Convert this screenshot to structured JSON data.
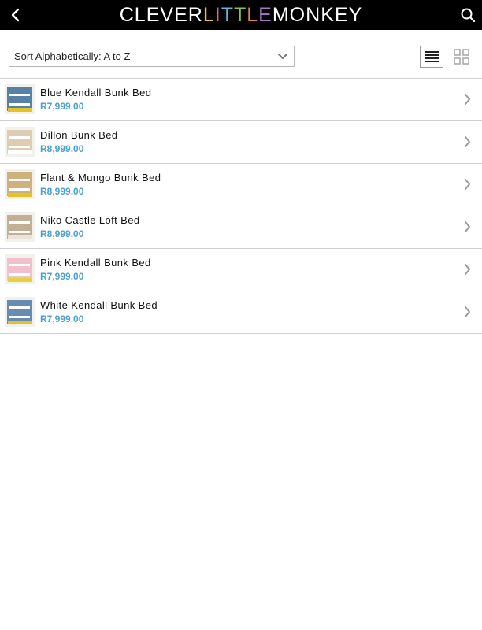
{
  "header": {
    "back_icon": "chevron-left-icon",
    "search_icon": "search-icon",
    "logo_letters": [
      {
        "char": "C",
        "color": "#ffffff"
      },
      {
        "char": "L",
        "color": "#ffffff"
      },
      {
        "char": "E",
        "color": "#ffffff"
      },
      {
        "char": "V",
        "color": "#ffffff"
      },
      {
        "char": "E",
        "color": "#ffffff"
      },
      {
        "char": "R",
        "color": "#ffffff"
      },
      {
        "char": "L",
        "color": "#f2c12e"
      },
      {
        "char": "I",
        "color": "#e8628a"
      },
      {
        "char": "T",
        "color": "#5bb6e0"
      },
      {
        "char": "T",
        "color": "#8ec044"
      },
      {
        "char": "L",
        "color": "#e5883a"
      },
      {
        "char": "E",
        "color": "#a577c9"
      },
      {
        "char": "M",
        "color": "#ffffff"
      },
      {
        "char": "O",
        "color": "#ffffff"
      },
      {
        "char": "N",
        "color": "#ffffff"
      },
      {
        "char": "K",
        "color": "#ffffff"
      },
      {
        "char": "E",
        "color": "#ffffff"
      },
      {
        "char": "Y",
        "color": "#ffffff"
      }
    ]
  },
  "toolbar": {
    "sort_label": "Sort Alphabetically: A to Z",
    "sort_icon": "chevron-down-icon",
    "list_view_icon": "list-view-icon",
    "grid_view_icon": "grid-view-icon"
  },
  "products": [
    {
      "name": "Blue Kendall Bunk Bed",
      "price": "R7,999.00",
      "thumb_color": "#3b6f9a",
      "accent": "#e6c22a"
    },
    {
      "name": "Dillon Bunk Bed",
      "price": "R8,999.00",
      "thumb_color": "#d9c7a8",
      "accent": "#ffffff"
    },
    {
      "name": "Flant & Mungo Bunk Bed",
      "price": "R8,999.00",
      "thumb_color": "#c9a46a",
      "accent": "#e6c22a"
    },
    {
      "name": "Niko Castle Loft Bed",
      "price": "R8,999.00",
      "thumb_color": "#b8a386",
      "accent": "#e9e4da"
    },
    {
      "name": "Pink Kendall Bunk Bed",
      "price": "R7,999.00",
      "thumb_color": "#f1b7c8",
      "accent": "#e6d33a"
    },
    {
      "name": "White Kendall Bunk Bed",
      "price": "R7,999.00",
      "thumb_color": "#4f7aa6",
      "accent": "#e6c22a"
    }
  ],
  "colors": {
    "header_bg": "#000000",
    "price": "#4a9fd0",
    "divider": "#cfcfcf"
  }
}
